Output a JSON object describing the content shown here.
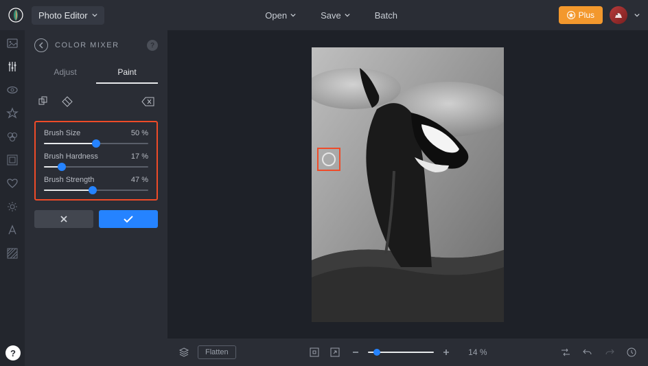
{
  "header": {
    "app_name": "Photo Editor",
    "open_label": "Open",
    "save_label": "Save",
    "batch_label": "Batch",
    "plus_label": "Plus"
  },
  "panel": {
    "title": "COLOR MIXER",
    "tabs": {
      "adjust": "Adjust",
      "paint": "Paint",
      "active": "paint"
    }
  },
  "sliders": {
    "size": {
      "label": "Brush Size",
      "value_text": "50 %",
      "pct": 50
    },
    "hardness": {
      "label": "Brush Hardness",
      "value_text": "17 %",
      "pct": 17
    },
    "strength": {
      "label": "Brush Strength",
      "value_text": "47 %",
      "pct": 47
    }
  },
  "bottom": {
    "flatten_label": "Flatten",
    "zoom_text": "14 %",
    "zoom_pct": 14
  },
  "colors": {
    "accent": "#2583ff",
    "highlight": "#ef4b28",
    "plus_button": "#f3982d"
  }
}
